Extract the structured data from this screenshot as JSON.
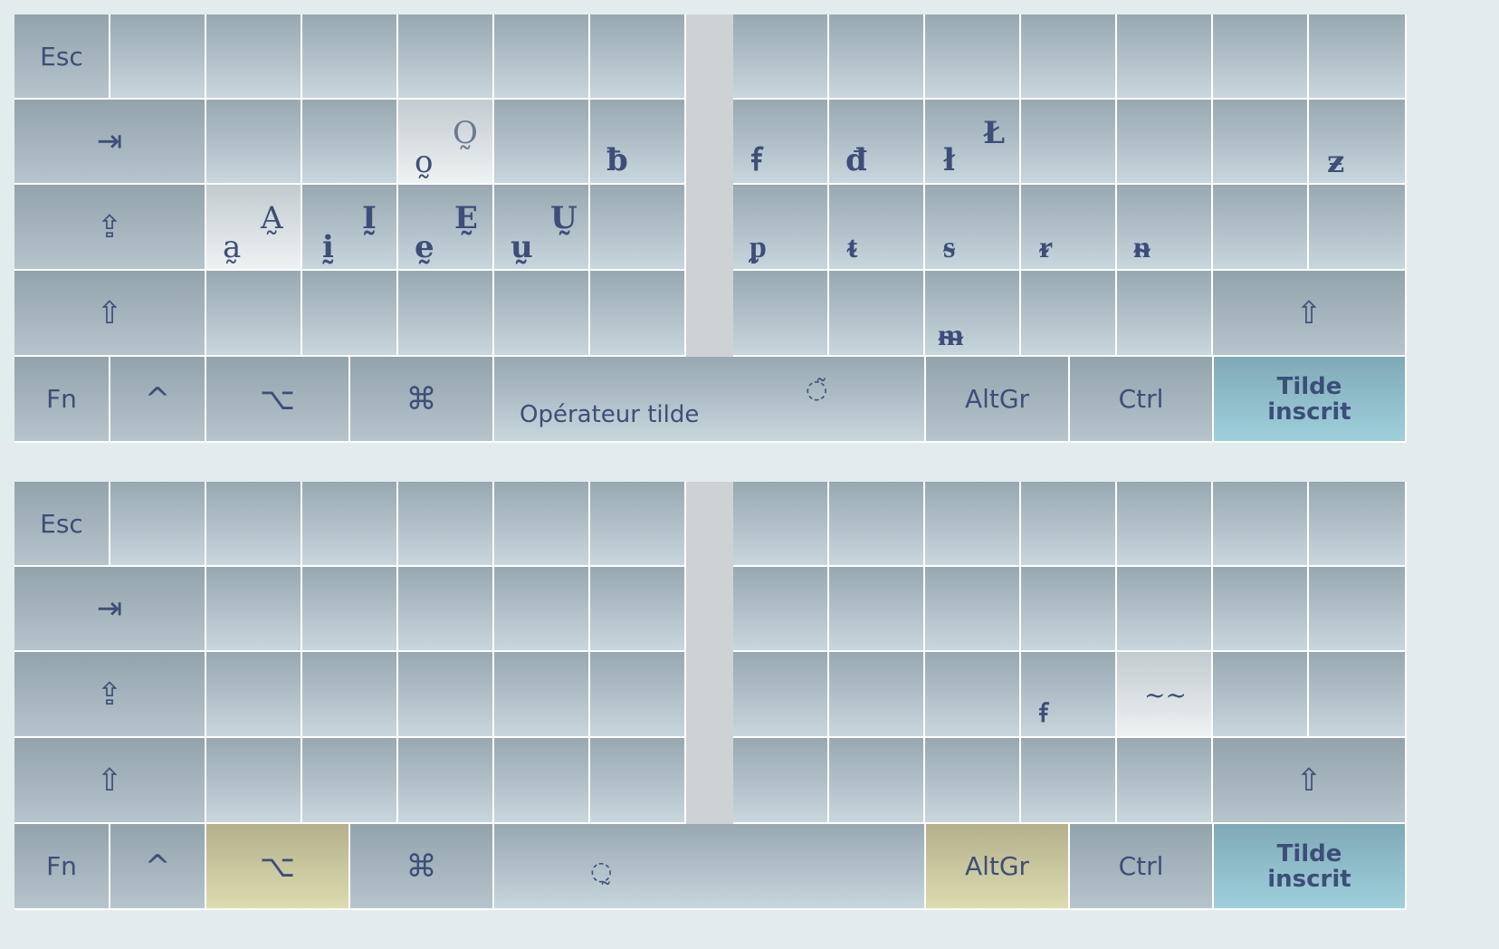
{
  "keys": {
    "esc": "Esc",
    "tab": "⇥",
    "caps": "⇪",
    "shift": "⇧",
    "fn": "Fn",
    "ctrl_sym": "^",
    "option": "⌥",
    "command": "⌘",
    "altgr": "AltGr",
    "ctrl": "Ctrl",
    "tilde_inscrit_1": "Tilde",
    "tilde_inscrit_2": "inscrit"
  },
  "top": {
    "space_label": "Opérateur tilde",
    "space_glyph": "◌̃",
    "row2": {
      "o_low": "o̰",
      "o_up": "O̰",
      "b": "ƀ",
      "f": "ꞙ",
      "d": "đ",
      "l_low": "ł",
      "l_up": "Ł",
      "z": "ƶ"
    },
    "row3": {
      "a_low": "a̰",
      "a_up": "A̰",
      "i_low": "ḭ",
      "i_up": "Ḭ",
      "e_low": "ḛ",
      "e_up": "Ḛ",
      "u_low": "ṵ",
      "u_up": "Ṵ",
      "p": "ᵱ",
      "t": "ᵵ",
      "s": "ᵴ",
      "r": "ᵲ",
      "n": "ᵰ"
    },
    "row4": {
      "m": "ᵯ"
    }
  },
  "bottom": {
    "space_glyph": "◌̰",
    "row3": {
      "f": "ꞙ",
      "tilde": "~~"
    }
  },
  "colors": {
    "key_gradient_top": "#98a8b1",
    "key_gradient_bottom": "#c8d6dd",
    "teal_key": "#8cbcc8",
    "olive_key": "#c8c49c",
    "text": "#3d4e7a",
    "background": "#e3ecec"
  }
}
